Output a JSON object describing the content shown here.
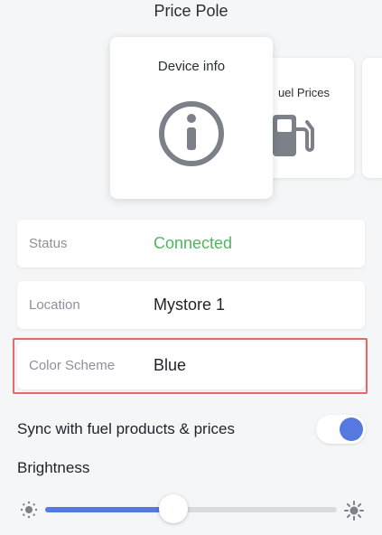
{
  "header": {
    "title": "Price Pole"
  },
  "cards": {
    "device_info": {
      "label": "Device info",
      "icon": "info-circle-icon"
    },
    "fuel_prices": {
      "label": "uel Prices",
      "icon": "fuel-pump-icon"
    }
  },
  "info_rows": [
    {
      "label": "Status",
      "value": "Connected",
      "value_color": "#4cb85c"
    },
    {
      "label": "Location",
      "value": "Mystore 1"
    },
    {
      "label": "Color Scheme",
      "value": "Blue",
      "highlight_color": "#e26a6a"
    }
  ],
  "sync": {
    "label": "Sync with fuel products & prices",
    "enabled": true
  },
  "brightness": {
    "label": "Brightness",
    "level": 0.44
  },
  "colors": {
    "accent": "#5579e0",
    "status_ok": "#4cb85c"
  }
}
